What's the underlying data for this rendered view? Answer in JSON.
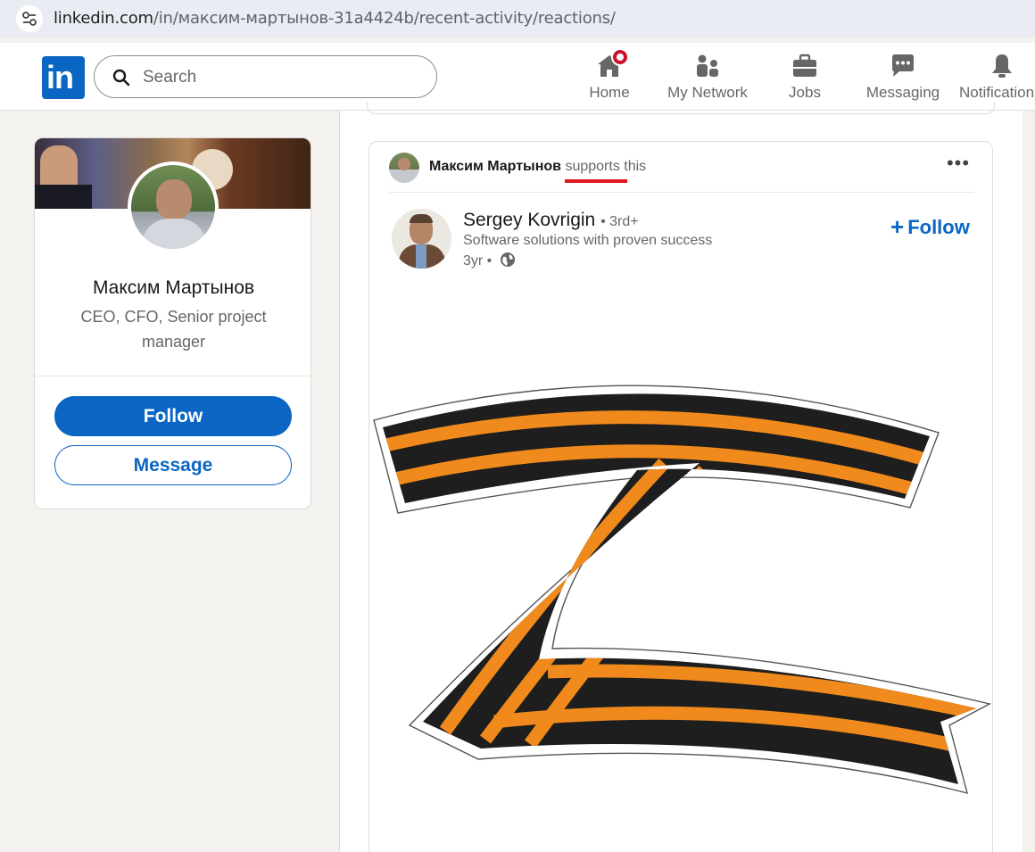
{
  "browser": {
    "url_host": "linkedin.com",
    "url_path": "/in/максим-мартынов-31a4424b/recent-activity/reactions/"
  },
  "nav": {
    "logo_text": "in",
    "search_placeholder": "Search",
    "items": [
      {
        "label": "Home",
        "icon": "home-icon",
        "has_badge": true
      },
      {
        "label": "My Network",
        "icon": "network-icon"
      },
      {
        "label": "Jobs",
        "icon": "briefcase-icon"
      },
      {
        "label": "Messaging",
        "icon": "messaging-icon"
      },
      {
        "label": "Notifications",
        "icon": "bell-icon"
      }
    ]
  },
  "profile": {
    "name": "Максим Мартынов",
    "headline": "CEO, CFO, Senior project manager",
    "follow_label": "Follow",
    "message_label": "Message"
  },
  "post": {
    "reactor_name": "Максим Мартынов",
    "reaction_verb": "supports",
    "reaction_suffix": "this",
    "author_name": "Sergey Kovrigin",
    "author_degree": "• 3rd+",
    "author_headline": "Software solutions with proven success",
    "post_age": "3yr •",
    "follow_label": "Follow",
    "image_description_icon": "z-ribbon-image"
  },
  "colors": {
    "linkedin_blue": "#0a66c2",
    "badge_red": "#cb112d",
    "annotation_red": "#e0141e",
    "ribbon_orange": "#f08a1c",
    "ribbon_black": "#1e1e1e"
  }
}
